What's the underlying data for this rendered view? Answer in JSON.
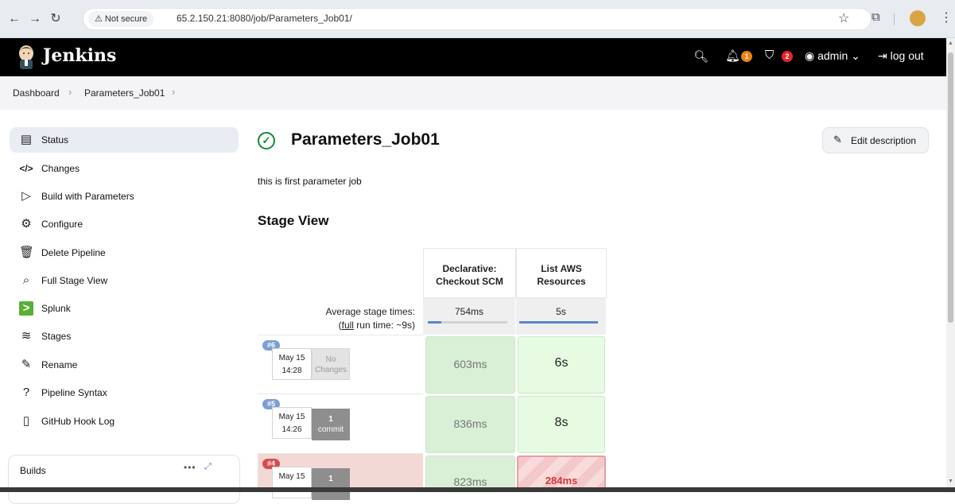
{
  "browser": {
    "not_secure": "Not secure",
    "url": "65.2.150.21:8080/job/Parameters_Job01/"
  },
  "header": {
    "app_name": "Jenkins",
    "notifications_count": "1",
    "security_count": "2",
    "user": "admin",
    "logout": "log out"
  },
  "breadcrumb": {
    "items": [
      "Dashboard",
      "Parameters_Job01"
    ]
  },
  "sidebar": {
    "tasks": [
      {
        "label": "Status"
      },
      {
        "label": "Changes"
      },
      {
        "label": "Build with Parameters"
      },
      {
        "label": "Configure"
      },
      {
        "label": "Delete Pipeline"
      },
      {
        "label": "Full Stage View"
      },
      {
        "label": "Splunk"
      },
      {
        "label": "Stages"
      },
      {
        "label": "Rename"
      },
      {
        "label": "Pipeline Syntax"
      },
      {
        "label": "GitHub Hook Log"
      }
    ],
    "builds_title": "Builds"
  },
  "main": {
    "job_title": "Parameters_Job01",
    "edit_description": "Edit description",
    "description": "this is first parameter job",
    "stage_view_heading": "Stage View"
  },
  "stage_view": {
    "stages": [
      {
        "name_line1": "Declarative:",
        "name_line2": "Checkout SCM",
        "avg": "754ms",
        "avg_fraction": 0.85
      },
      {
        "name_line1": "List AWS",
        "name_line2": "Resources",
        "avg": "5s",
        "avg_fraction": 1.0
      }
    ],
    "avg_label": "Average stage times:",
    "full_link": "full",
    "full_run_time": "run time: ~9s",
    "full_paren_open": "(",
    "full_paren_close": ")",
    "runs": [
      {
        "badge": "#6",
        "date": "May 15",
        "time": "14:28",
        "changes_top": "No",
        "changes_bottom": "Changes",
        "stage_times": [
          "603ms",
          "6s"
        ],
        "status": "success"
      },
      {
        "badge": "#5",
        "date": "May 15",
        "time": "14:26",
        "changes_top": "1",
        "changes_bottom": "commit",
        "stage_times": [
          "836ms",
          "8s"
        ],
        "status": "success"
      },
      {
        "badge": "#4",
        "date": "May 15",
        "time": "",
        "changes_top": "1",
        "changes_bottom": "",
        "stage_times": [
          "823ms",
          "284ms"
        ],
        "status": "failed"
      }
    ]
  },
  "colors": {
    "success_badge": "#7b9fd2",
    "failed_badge": "#d94c4c"
  }
}
